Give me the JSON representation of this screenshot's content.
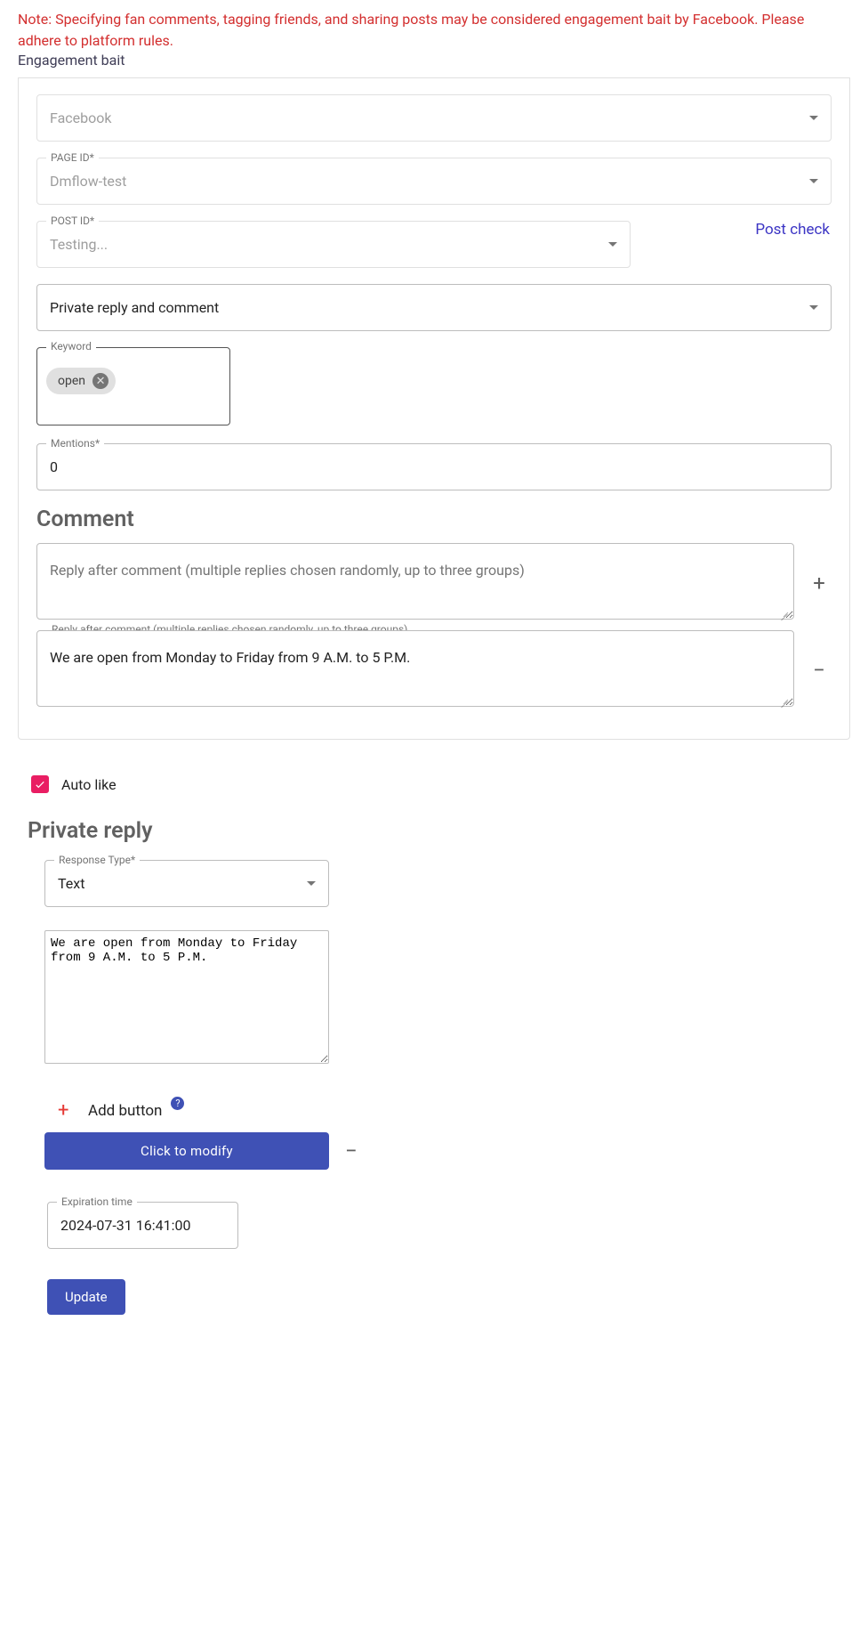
{
  "note": {
    "text": "Note: Specifying fan comments, tagging friends, and sharing posts may be considered engagement bait by Facebook. Please adhere to platform rules.",
    "link": "Engagement bait"
  },
  "platform": {
    "value": "Facebook"
  },
  "page_id": {
    "label": "PAGE ID*",
    "value": "Dmflow-test"
  },
  "post_id": {
    "label": "POST ID*",
    "value": "Testing...",
    "check_label": "Post check"
  },
  "reply_mode": {
    "value": "Private reply and comment"
  },
  "keyword": {
    "label": "Keyword",
    "chips": [
      "open"
    ]
  },
  "mentions": {
    "label": "Mentions*",
    "value": "0"
  },
  "comment": {
    "title": "Comment",
    "placeholder": "Reply after comment (multiple replies chosen randomly, up to three groups)",
    "float_label": "Reply after comment (multiple replies chosen randomly, up to three groups)",
    "reply_1": "We are open from Monday to Friday from 9 A.M. to 5 P.M."
  },
  "auto_like": {
    "label": "Auto like",
    "checked": true
  },
  "private_reply": {
    "title": "Private reply",
    "response_type_label": "Response Type*",
    "response_type_value": "Text",
    "text_value": "We are open from Monday to Friday from 9 A.M. to 5 P.M.",
    "add_button_label": "Add button",
    "modify_label": "Click to modify"
  },
  "expiration": {
    "label": "Expiration time",
    "value": "2024-07-31 16:41:00"
  },
  "update_label": "Update"
}
